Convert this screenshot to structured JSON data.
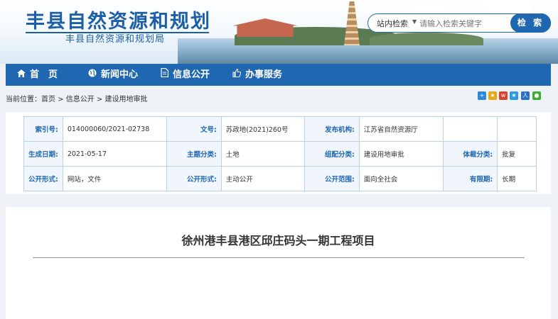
{
  "header": {
    "site_title": "丰县自然资源和规划",
    "site_subtitle": "丰县自然资源和规划局",
    "search": {
      "scope": "站内检索",
      "placeholder": "请输入检索关键字",
      "button": "检 索"
    }
  },
  "nav": {
    "items": [
      {
        "label": "首　页",
        "icon": "home-icon"
      },
      {
        "label": "新闻中心",
        "icon": "globe-icon"
      },
      {
        "label": "信息公开",
        "icon": "document-icon"
      },
      {
        "label": "办事服务",
        "icon": "thumbs-up-icon"
      }
    ]
  },
  "breadcrumb": {
    "text": "当前位置：首页 > 信息公开 > 建设用地审批"
  },
  "share_icons": [
    "plus-icon",
    "star-icon",
    "weibo-icon",
    "qzone-icon",
    "tencent-icon",
    "wechat-icon"
  ],
  "meta": {
    "rows": [
      [
        {
          "k": "索引号:",
          "v": "014000060/2021-02738"
        },
        {
          "k": "文号:",
          "v": "苏政地(2021)260号"
        },
        {
          "k": "发布机构:",
          "v": "江苏省自然资源厅"
        },
        {
          "k": "",
          "v": ""
        }
      ],
      [
        {
          "k": "生成日期:",
          "v": "2021-05-17"
        },
        {
          "k": "主题分类:",
          "v": "土地"
        },
        {
          "k": "组配分类:",
          "v": "建设用地审批"
        },
        {
          "k": "体裁分类:",
          "v": "批复"
        }
      ],
      [
        {
          "k": "公开形式:",
          "v": "网站，文件"
        },
        {
          "k": "公开形式:",
          "v": "主动公开"
        },
        {
          "k": "公开范围:",
          "v": "面向全社会"
        },
        {
          "k": "有限期:",
          "v": "长期"
        }
      ]
    ]
  },
  "article": {
    "title": "徐州港丰县港区邱庄码头一期工程项目"
  },
  "colors": {
    "brand": "#1f67b0",
    "title": "#1d5fa5",
    "background": "#eef1f5"
  }
}
